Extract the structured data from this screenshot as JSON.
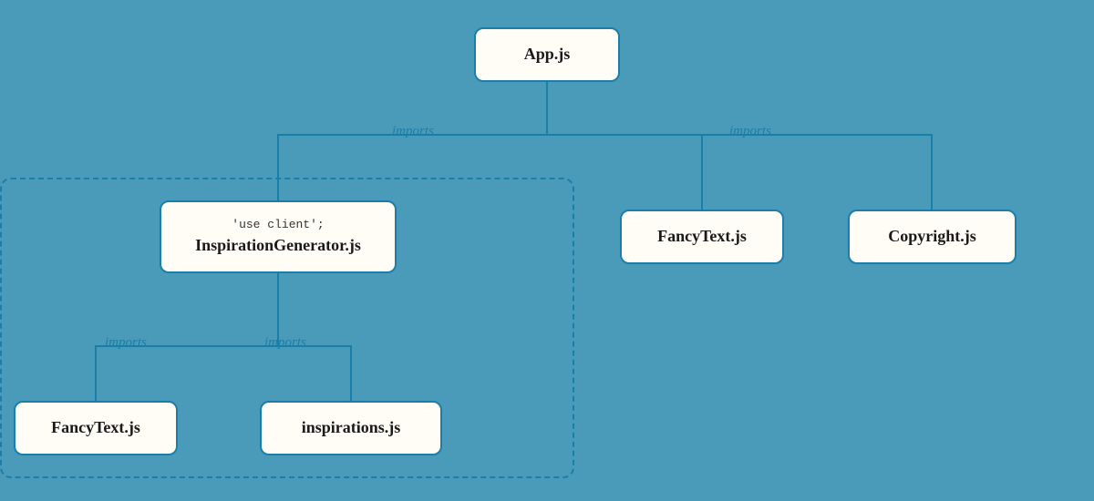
{
  "nodes": {
    "appjs": {
      "label": "App.js"
    },
    "inspiration": {
      "use_client": "'use client';",
      "label": "InspirationGenerator.js"
    },
    "fancytext_top": {
      "label": "FancyText.js"
    },
    "copyright": {
      "label": "Copyright.js"
    },
    "fancytext_bottom": {
      "label": "FancyText.js"
    },
    "inspirations": {
      "label": "inspirations.js"
    }
  },
  "labels": {
    "imports": "imports"
  },
  "colors": {
    "background": "#4a9aba",
    "border": "#1a7fa8",
    "node_bg": "#fffdf5",
    "text": "#1a1a1a"
  }
}
